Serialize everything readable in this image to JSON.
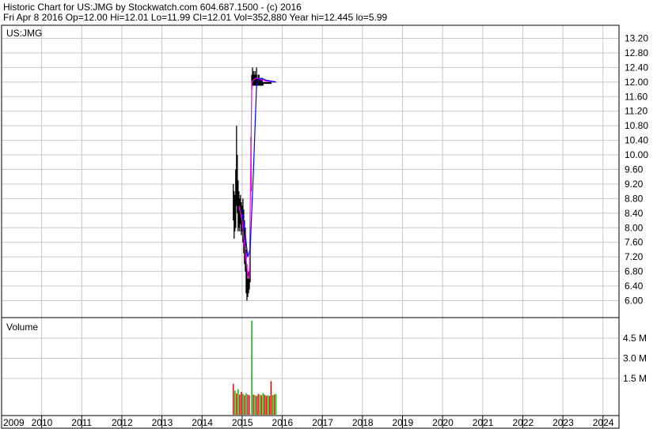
{
  "header": {
    "line1": "Historic Chart for US:JMG by Stockwatch.com 604.687.1500 - (c) 2016",
    "line2": "Fri Apr  8 2016   Op=12.00   Hi=12.01   Lo=11.99   Cl=12.01   Vol=352,880   Year hi=12.445   lo=5.99"
  },
  "colors": {
    "price_bars": "#000000",
    "ma_short": "#ff00ff",
    "ma_long": "#0000ff",
    "volume_up": "#00aa00",
    "volume_down": "#cc0000",
    "grid": "#c8c8c8",
    "border": "#000000"
  },
  "chart_data": [
    {
      "type": "line",
      "panel": "price",
      "title": "US:JMG",
      "ylim": [
        5.8,
        13.4
      ],
      "y_ticks": [
        "13.20",
        "12.80",
        "12.40",
        "12.00",
        "11.60",
        "11.20",
        "10.80",
        "10.40",
        "10.00",
        "9.60",
        "9.20",
        "8.80",
        "8.40",
        "8.00",
        "7.60",
        "7.20",
        "6.80",
        "6.40",
        "6.00"
      ],
      "x_ticks": [
        "2009",
        "2010",
        "2011",
        "2012",
        "2013",
        "2014",
        "2015",
        "2016",
        "2017",
        "2018",
        "2019",
        "2020",
        "2021",
        "2022",
        "2023",
        "2024"
      ],
      "grid": true,
      "series": [
        {
          "role": "price_range",
          "x": [
            2014.78,
            2014.8,
            2014.82,
            2014.84,
            2014.86,
            2014.88,
            2014.9,
            2014.92,
            2014.94,
            2014.96,
            2014.98,
            2015.0,
            2015.02,
            2015.04,
            2015.06,
            2015.08,
            2015.1,
            2015.12,
            2015.14,
            2015.16,
            2015.18,
            2015.2,
            2015.22,
            2015.24,
            2015.26,
            2015.28,
            2015.3,
            2015.32,
            2015.34,
            2015.36,
            2015.38,
            2015.4,
            2015.42,
            2015.44,
            2015.46,
            2015.48,
            2015.5,
            2015.52,
            2015.54,
            2015.56,
            2015.58,
            2015.6,
            2015.62,
            2015.64,
            2015.66,
            2015.68,
            2015.7,
            2015.72,
            2015.74,
            2015.76,
            2015.78,
            2015.8,
            2015.82,
            2015.84
          ],
          "high": [
            9.2,
            9.0,
            8.9,
            9.6,
            10.8,
            10.0,
            9.3,
            9.0,
            8.8,
            8.9,
            8.7,
            8.6,
            8.8,
            8.5,
            8.2,
            8.0,
            7.4,
            7.0,
            6.6,
            6.8,
            6.6,
            7.6,
            10.5,
            12.2,
            12.4,
            12.3,
            12.2,
            12.3,
            12.2,
            12.4,
            12.1,
            12.2,
            12.2,
            12.1,
            12.1,
            12.1,
            12.1,
            12.0,
            12.0,
            12.0,
            12.0,
            12.0,
            12.0,
            12.0,
            12.0,
            12.0,
            12.0,
            12.0,
            12.0,
            12.0,
            12.0,
            12.0,
            12.0,
            12.0
          ],
          "low": [
            8.2,
            7.7,
            7.9,
            8.0,
            8.6,
            8.4,
            7.9,
            8.0,
            7.9,
            8.1,
            7.8,
            7.9,
            7.6,
            7.3,
            7.0,
            6.8,
            6.2,
            6.0,
            6.1,
            6.2,
            6.3,
            6.5,
            9.0,
            11.8,
            11.9,
            11.9,
            11.9,
            11.9,
            11.9,
            11.9,
            11.9,
            11.9,
            11.9,
            11.9,
            11.9,
            11.9,
            11.9,
            11.9,
            11.95,
            11.95,
            11.95,
            11.95,
            11.95,
            11.95,
            11.95,
            11.95,
            11.95,
            11.95,
            11.99,
            11.99,
            11.99,
            11.99,
            11.99,
            11.99
          ]
        },
        {
          "role": "moving_average_short",
          "x": [
            2014.92,
            2015.0,
            2015.08,
            2015.14,
            2015.18,
            2015.24,
            2015.32,
            2015.4,
            2015.5,
            2015.6,
            2015.7,
            2015.84
          ],
          "values": [
            8.6,
            8.2,
            7.3,
            6.7,
            6.6,
            12.0,
            12.1,
            12.1,
            12.05,
            12.03,
            12.02,
            12.01
          ]
        },
        {
          "role": "moving_average_long",
          "x": [
            2014.98,
            2015.06,
            2015.14,
            2015.2,
            2015.28,
            2015.36,
            2015.42,
            2015.5,
            2015.6,
            2015.7,
            2015.84
          ],
          "values": [
            8.5,
            8.0,
            7.2,
            7.4,
            9.5,
            11.9,
            12.1,
            12.1,
            12.05,
            12.03,
            12.0
          ]
        }
      ]
    },
    {
      "type": "bar",
      "panel": "volume",
      "title": "Volume",
      "ylim": [
        0,
        5800000
      ],
      "y_ticks": [
        {
          "label": "4.5 M",
          "value": 4500000
        },
        {
          "label": "3.0 M",
          "value": 3000000
        },
        {
          "label": "1.5 M",
          "value": 1500000
        }
      ],
      "x_ticks": [
        "2009",
        "2010",
        "2011",
        "2012",
        "2013",
        "2014",
        "2015",
        "2016",
        "2017",
        "2018",
        "2019",
        "2020",
        "2021",
        "2022",
        "2023",
        "2024"
      ],
      "grid": true,
      "x": [
        2014.78,
        2014.82,
        2014.86,
        2014.9,
        2014.94,
        2014.98,
        2015.02,
        2015.06,
        2015.1,
        2015.14,
        2015.18,
        2015.24,
        2015.28,
        2015.32,
        2015.36,
        2015.4,
        2015.44,
        2015.48,
        2015.52,
        2015.56,
        2015.6,
        2015.64,
        2015.68,
        2015.72,
        2015.76,
        2015.8,
        2015.84
      ],
      "values": [
        1100000,
        600000,
        400000,
        700000,
        300000,
        500000,
        350000,
        250000,
        400000,
        300000,
        250000,
        5800000,
        300000,
        250000,
        200000,
        350000,
        300000,
        250000,
        400000,
        300000,
        200000,
        250000,
        200000,
        1300000,
        250000,
        300000,
        350000
      ],
      "up": [
        false,
        true,
        false,
        true,
        false,
        false,
        true,
        false,
        true,
        false,
        false,
        true,
        false,
        true,
        false,
        false,
        true,
        false,
        true,
        false,
        false,
        true,
        false,
        false,
        true,
        false,
        true
      ]
    }
  ]
}
